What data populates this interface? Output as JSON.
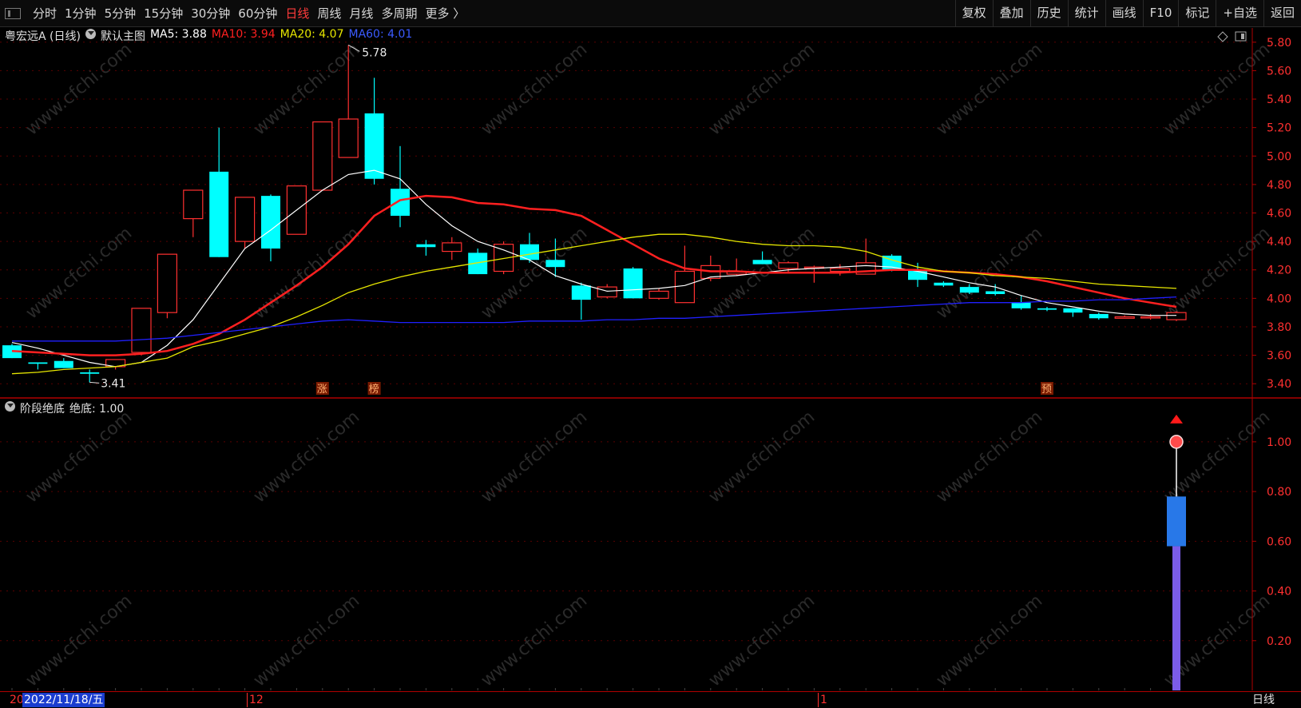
{
  "toolbar": {
    "tabs": [
      "分时",
      "1分钟",
      "5分钟",
      "15分钟",
      "30分钟",
      "60分钟",
      "日线",
      "周线",
      "月线",
      "多周期",
      "更多 〉"
    ],
    "active_tab": "日线",
    "right_buttons": [
      "复权",
      "叠加",
      "历史",
      "统计",
      "画线",
      "F10",
      "标记",
      "+自选",
      "返回"
    ]
  },
  "main_legend": {
    "stock_name": "粤宏远A (日线)",
    "template": "默认主图",
    "ma5": "MA5: 3.88",
    "ma10": "MA10: 3.94",
    "ma20": "MA20: 4.07",
    "ma60": "MA60: 4.01"
  },
  "indicator_legend": {
    "name": "阶段绝底",
    "value": "绝底: 1.00"
  },
  "bottom_bar": {
    "date_badge": "2022/11/18/五",
    "edge_label": "20",
    "month_label_1": "12",
    "month_label_2": "1",
    "period_button": "日线"
  },
  "watermark": "www.cfchi.com",
  "colors": {
    "up": "#ff3030",
    "down": "#00ffff",
    "ma5": "#ffffff",
    "ma10": "#ff2020",
    "ma20": "#e6e600",
    "ma60": "#2020ff",
    "axis": "#b00000",
    "bar_top": "#2878e8",
    "bar_bottom": "#7b5ce8"
  },
  "chart_data": [
    {
      "type": "candlestick",
      "ylim": [
        3.3,
        5.9
      ],
      "y_ticks": [
        "5.80",
        "5.60",
        "5.40",
        "5.20",
        "5.00",
        "4.80",
        "4.60",
        "4.40",
        "4.20",
        "4.00",
        "3.80",
        "3.60",
        "3.40"
      ],
      "annotations": {
        "high_label": "5.78",
        "low_label": "3.41"
      },
      "markers": [
        {
          "index": 12,
          "label": "涨"
        },
        {
          "index": 14,
          "label": "榜"
        },
        {
          "index": 40,
          "label": "预"
        }
      ],
      "candles": [
        {
          "o": 3.67,
          "h": 3.68,
          "l": 3.58,
          "c": 3.58
        },
        {
          "o": 3.55,
          "h": 3.55,
          "l": 3.5,
          "c": 3.54
        },
        {
          "o": 3.56,
          "h": 3.58,
          "l": 3.51,
          "c": 3.51
        },
        {
          "o": 3.48,
          "h": 3.5,
          "l": 3.41,
          "c": 3.47
        },
        {
          "o": 3.52,
          "h": 3.57,
          "l": 3.5,
          "c": 3.57
        },
        {
          "o": 3.62,
          "h": 3.93,
          "l": 3.6,
          "c": 3.93
        },
        {
          "o": 3.9,
          "h": 4.31,
          "l": 3.86,
          "c": 4.31
        },
        {
          "o": 4.56,
          "h": 4.76,
          "l": 4.43,
          "c": 4.76
        },
        {
          "o": 4.89,
          "h": 5.2,
          "l": 4.29,
          "c": 4.29
        },
        {
          "o": 4.4,
          "h": 4.71,
          "l": 4.35,
          "c": 4.71
        },
        {
          "o": 4.72,
          "h": 4.73,
          "l": 4.26,
          "c": 4.35
        },
        {
          "o": 4.45,
          "h": 4.79,
          "l": 4.45,
          "c": 4.79
        },
        {
          "o": 4.76,
          "h": 5.24,
          "l": 4.76,
          "c": 5.24
        },
        {
          "o": 4.99,
          "h": 5.78,
          "l": 4.99,
          "c": 5.26
        },
        {
          "o": 5.3,
          "h": 5.55,
          "l": 4.8,
          "c": 4.84
        },
        {
          "o": 4.77,
          "h": 5.07,
          "l": 4.5,
          "c": 4.58
        },
        {
          "o": 4.38,
          "h": 4.41,
          "l": 4.3,
          "c": 4.36
        },
        {
          "o": 4.33,
          "h": 4.43,
          "l": 4.27,
          "c": 4.39
        },
        {
          "o": 4.32,
          "h": 4.35,
          "l": 4.17,
          "c": 4.17
        },
        {
          "o": 4.19,
          "h": 4.4,
          "l": 4.17,
          "c": 4.38
        },
        {
          "o": 4.38,
          "h": 4.46,
          "l": 4.25,
          "c": 4.27
        },
        {
          "o": 4.27,
          "h": 4.42,
          "l": 4.15,
          "c": 4.22
        },
        {
          "o": 4.09,
          "h": 4.11,
          "l": 3.85,
          "c": 3.99
        },
        {
          "o": 4.01,
          "h": 4.1,
          "l": 4.0,
          "c": 4.08
        },
        {
          "o": 4.21,
          "h": 4.22,
          "l": 4.0,
          "c": 4.0
        },
        {
          "o": 4.0,
          "h": 4.07,
          "l": 3.99,
          "c": 4.05
        },
        {
          "o": 3.97,
          "h": 4.37,
          "l": 3.97,
          "c": 4.19
        },
        {
          "o": 4.14,
          "h": 4.3,
          "l": 4.12,
          "c": 4.23
        },
        {
          "o": 4.17,
          "h": 4.28,
          "l": 4.16,
          "c": 4.19
        },
        {
          "o": 4.27,
          "h": 4.33,
          "l": 4.24,
          "c": 4.24
        },
        {
          "o": 4.21,
          "h": 4.26,
          "l": 4.18,
          "c": 4.25
        },
        {
          "o": 4.22,
          "h": 4.23,
          "l": 4.11,
          "c": 4.22
        },
        {
          "o": 4.19,
          "h": 4.24,
          "l": 4.16,
          "c": 4.21
        },
        {
          "o": 4.17,
          "h": 4.42,
          "l": 4.17,
          "c": 4.25
        },
        {
          "o": 4.3,
          "h": 4.31,
          "l": 4.19,
          "c": 4.2
        },
        {
          "o": 4.2,
          "h": 4.25,
          "l": 4.08,
          "c": 4.13
        },
        {
          "o": 4.11,
          "h": 4.12,
          "l": 4.08,
          "c": 4.09
        },
        {
          "o": 4.08,
          "h": 4.1,
          "l": 4.03,
          "c": 4.04
        },
        {
          "o": 4.05,
          "h": 4.1,
          "l": 4.02,
          "c": 4.03
        },
        {
          "o": 3.97,
          "h": 4.02,
          "l": 3.92,
          "c": 3.93
        },
        {
          "o": 3.93,
          "h": 3.94,
          "l": 3.91,
          "c": 3.92
        },
        {
          "o": 3.93,
          "h": 3.93,
          "l": 3.87,
          "c": 3.9
        },
        {
          "o": 3.89,
          "h": 3.9,
          "l": 3.85,
          "c": 3.86
        },
        {
          "o": 3.86,
          "h": 3.88,
          "l": 3.86,
          "c": 3.87
        },
        {
          "o": 3.87,
          "h": 3.89,
          "l": 3.85,
          "c": 3.87
        },
        {
          "o": 3.85,
          "h": 3.91,
          "l": 3.84,
          "c": 3.9
        }
      ],
      "series": [
        {
          "name": "MA5",
          "values": [
            3.69,
            3.65,
            3.6,
            3.55,
            3.52,
            3.55,
            3.67,
            3.85,
            4.1,
            4.35,
            4.48,
            4.62,
            4.76,
            4.87,
            4.9,
            4.84,
            4.66,
            4.51,
            4.4,
            4.34,
            4.27,
            4.16,
            4.1,
            4.05,
            4.06,
            4.07,
            4.09,
            4.15,
            4.16,
            4.18,
            4.2,
            4.21,
            4.22,
            4.23,
            4.22,
            4.19,
            4.15,
            4.11,
            4.08,
            4.02,
            3.97,
            3.94,
            3.91,
            3.89,
            3.88,
            3.88
          ]
        },
        {
          "name": "MA10",
          "values": [
            3.63,
            3.62,
            3.61,
            3.6,
            3.6,
            3.61,
            3.63,
            3.68,
            3.75,
            3.85,
            3.97,
            4.09,
            4.22,
            4.38,
            4.58,
            4.69,
            4.72,
            4.71,
            4.67,
            4.66,
            4.63,
            4.62,
            4.58,
            4.48,
            4.38,
            4.28,
            4.21,
            4.19,
            4.19,
            4.18,
            4.18,
            4.18,
            4.18,
            4.19,
            4.2,
            4.2,
            4.19,
            4.18,
            4.17,
            4.15,
            4.12,
            4.08,
            4.04,
            4.0,
            3.97,
            3.94
          ]
        },
        {
          "name": "MA20",
          "values": [
            3.47,
            3.48,
            3.5,
            3.51,
            3.52,
            3.55,
            3.58,
            3.66,
            3.7,
            3.75,
            3.8,
            3.87,
            3.95,
            4.04,
            4.1,
            4.15,
            4.19,
            4.22,
            4.25,
            4.28,
            4.31,
            4.34,
            4.37,
            4.4,
            4.43,
            4.45,
            4.45,
            4.43,
            4.4,
            4.38,
            4.37,
            4.37,
            4.36,
            4.33,
            4.27,
            4.22,
            4.19,
            4.18,
            4.16,
            4.15,
            4.14,
            4.12,
            4.1,
            4.09,
            4.08,
            4.07
          ]
        },
        {
          "name": "MA60",
          "values": [
            3.7,
            3.7,
            3.7,
            3.7,
            3.7,
            3.71,
            3.72,
            3.74,
            3.76,
            3.78,
            3.8,
            3.82,
            3.84,
            3.85,
            3.84,
            3.83,
            3.83,
            3.83,
            3.83,
            3.83,
            3.84,
            3.84,
            3.84,
            3.85,
            3.85,
            3.86,
            3.86,
            3.87,
            3.88,
            3.89,
            3.9,
            3.91,
            3.92,
            3.93,
            3.94,
            3.95,
            3.96,
            3.97,
            3.97,
            3.97,
            3.98,
            3.98,
            3.99,
            3.99,
            4.0,
            4.01
          ]
        }
      ]
    },
    {
      "type": "bar",
      "name": "阶段绝底",
      "ylim": [
        0,
        1.17
      ],
      "y_ticks": [
        "1.00",
        "0.80",
        "0.60",
        "0.40",
        "0.20"
      ],
      "bar_index": 45,
      "bar_top": 0.78,
      "bar_mid": 0.58,
      "dot_value": 1.0,
      "arrow_value": 1.09
    }
  ]
}
